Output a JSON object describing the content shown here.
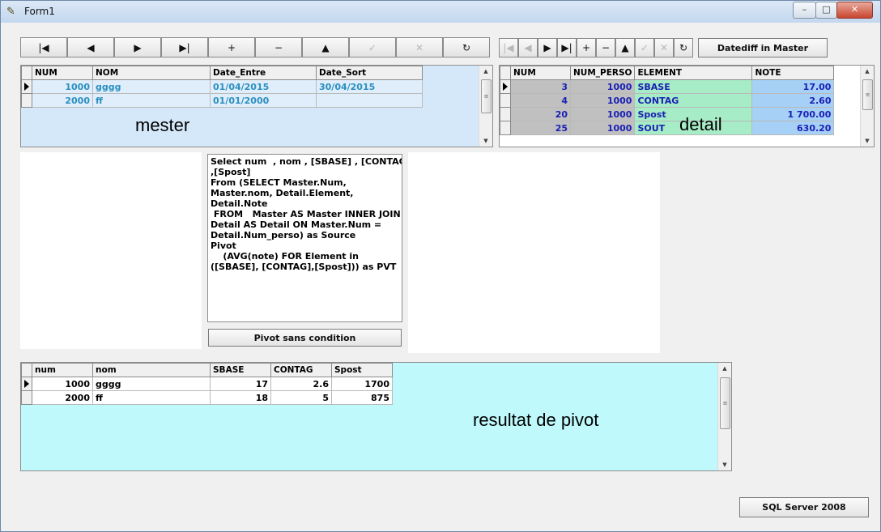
{
  "window": {
    "title": "Form1",
    "minimize": "–",
    "maximize": "□",
    "close": "✕"
  },
  "master_nav": {
    "buttons": [
      {
        "name": "nav-first-button",
        "glyph": "|◀",
        "enabled": true
      },
      {
        "name": "nav-prior-button",
        "glyph": "◀",
        "enabled": true
      },
      {
        "name": "nav-next-button",
        "glyph": "▶",
        "enabled": true
      },
      {
        "name": "nav-last-button",
        "glyph": "▶|",
        "enabled": true
      },
      {
        "name": "nav-insert-button",
        "glyph": "+",
        "enabled": true
      },
      {
        "name": "nav-delete-button",
        "glyph": "−",
        "enabled": true
      },
      {
        "name": "nav-edit-button",
        "glyph": "▲",
        "enabled": true
      },
      {
        "name": "nav-post-button",
        "glyph": "✓",
        "enabled": false
      },
      {
        "name": "nav-cancel-button",
        "glyph": "✕",
        "enabled": false
      },
      {
        "name": "nav-refresh-button",
        "glyph": "↻",
        "enabled": true
      }
    ]
  },
  "detail_nav": {
    "buttons": [
      {
        "name": "nav-first-button",
        "glyph": "|◀",
        "enabled": false
      },
      {
        "name": "nav-prior-button",
        "glyph": "◀",
        "enabled": false
      },
      {
        "name": "nav-next-button",
        "glyph": "▶",
        "enabled": true
      },
      {
        "name": "nav-last-button",
        "glyph": "▶|",
        "enabled": true
      },
      {
        "name": "nav-insert-button",
        "glyph": "+",
        "enabled": true
      },
      {
        "name": "nav-delete-button",
        "glyph": "−",
        "enabled": true
      },
      {
        "name": "nav-edit-button",
        "glyph": "▲",
        "enabled": true
      },
      {
        "name": "nav-post-button",
        "glyph": "✓",
        "enabled": false
      },
      {
        "name": "nav-cancel-button",
        "glyph": "✕",
        "enabled": false
      },
      {
        "name": "nav-refresh-button",
        "glyph": "↻",
        "enabled": true
      }
    ]
  },
  "datediff_button": "Datediff in Master",
  "master_grid": {
    "overlay_label": "mester",
    "columns": [
      "NUM",
      "NOM",
      "Date_Entre",
      "Date_Sort"
    ],
    "rows": [
      {
        "num": "1000",
        "nom": "gggg",
        "date_entre": "01/04/2015",
        "date_sort": "30/04/2015",
        "current": true
      },
      {
        "num": "2000",
        "nom": "ff",
        "date_entre": "01/01/2000",
        "date_sort": "",
        "current": false
      }
    ],
    "colors": {
      "background": "#d5e8fa",
      "cell_text": "#2a8fc0",
      "row_bg": "#e0eefb"
    }
  },
  "detail_grid": {
    "overlay_label": "detail",
    "columns": [
      "NUM",
      "NUM_PERSO",
      "ELEMENT",
      "NOTE"
    ],
    "rows": [
      {
        "num": "3",
        "num_perso": "1000",
        "element": "SBASE",
        "note": "17.00",
        "current": true
      },
      {
        "num": "4",
        "num_perso": "1000",
        "element": "CONTAG",
        "note": "2.60",
        "current": false
      },
      {
        "num": "20",
        "num_perso": "1000",
        "element": "Spost",
        "note": "1 700.00",
        "current": false
      },
      {
        "num": "25",
        "num_perso": "1000",
        "element": "SOUT",
        "note": "630.20",
        "current": false
      }
    ],
    "colors": {
      "num_bg": "#c0c0c0",
      "element_bg": "#a6ecc6",
      "note_bg": "#a6d0f6",
      "text": "#1a20b4"
    }
  },
  "sql_memo": {
    "lines": [
      "Select num  , nom , [SBASE] , [CONTAG]",
      ",[Spost]",
      "From (SELECT Master.Num,",
      "Master.nom, Detail.Element,",
      "Detail.Note",
      " FROM   Master AS Master INNER JOIN",
      "Detail AS Detail ON Master.Num =",
      "Detail.Num_perso) as Source",
      "Pivot",
      "    (AVG(note) FOR Element in",
      "([SBASE], [CONTAG],[Spost])) as PVT"
    ]
  },
  "pivot_button": "Pivot sans condition",
  "result_grid": {
    "overlay_label": "resultat de pivot",
    "columns": [
      "num",
      "nom",
      "SBASE",
      "CONTAG",
      "Spost"
    ],
    "rows": [
      {
        "num": "1000",
        "nom": "gggg",
        "sbase": "17",
        "contag": "2.6",
        "spost": "1700",
        "current": true
      },
      {
        "num": "2000",
        "nom": "ff",
        "sbase": "18",
        "contag": "5",
        "spost": "875",
        "current": false
      }
    ],
    "colors": {
      "background": "#bff9fc"
    }
  },
  "sql_server_button": "SQL Server 2008"
}
